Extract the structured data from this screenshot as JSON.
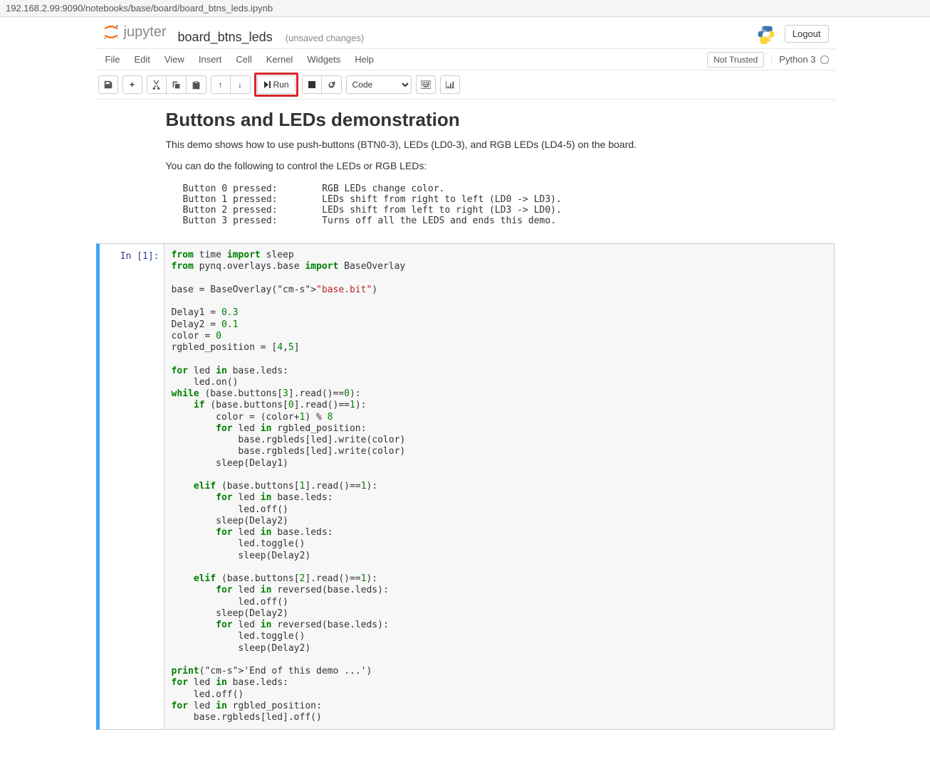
{
  "url": {
    "full": "192.168.2.99:9090/notebooks/base/board/board_btns_leds.ipynb"
  },
  "header": {
    "jupyter_brand": "jupyter",
    "notebook_name": "board_btns_leds",
    "save_status": "(unsaved changes)",
    "logout": "Logout"
  },
  "menu": {
    "items": [
      "File",
      "Edit",
      "View",
      "Insert",
      "Cell",
      "Kernel",
      "Widgets",
      "Help"
    ],
    "trust": "Not Trusted",
    "kernel": "Python 3"
  },
  "toolbar": {
    "run_label": "Run",
    "cell_type": "Code"
  },
  "markdown": {
    "title": "Buttons and LEDs demonstration",
    "p1": "This demo shows how to use push-buttons (BTN0-3), LEDs (LD0-3), and RGB LEDs (LD4-5) on the board.",
    "p2": "You can do the following to control the LEDs or RGB LEDs:",
    "pre": "Button 0 pressed:        RGB LEDs change color.\nButton 1 pressed:        LEDs shift from right to left (LD0 -> LD3).\nButton 2 pressed:        LEDs shift from left to right (LD3 -> LD0).\nButton 3 pressed:        Turns off all the LEDS and ends this demo."
  },
  "cell1": {
    "prompt": "In [1]:",
    "code_plain": "from time import sleep\nfrom pynq.overlays.base import BaseOverlay\n\nbase = BaseOverlay(\"base.bit\")\n\nDelay1 = 0.3\nDelay2 = 0.1\ncolor = 0\nrgbled_position = [4,5]\n\nfor led in base.leds:\n    led.on()\nwhile (base.buttons[3].read()==0):\n    if (base.buttons[0].read()==1):\n        color = (color+1) % 8\n        for led in rgbled_position:\n            base.rgbleds[led].write(color)\n            base.rgbleds[led].write(color)\n        sleep(Delay1)\n        \n    elif (base.buttons[1].read()==1):\n        for led in base.leds:\n            led.off()\n        sleep(Delay2)\n        for led in base.leds:\n            led.toggle()\n            sleep(Delay2)\n            \n    elif (base.buttons[2].read()==1):\n        for led in reversed(base.leds):\n            led.off()\n        sleep(Delay2)\n        for led in reversed(base.leds):\n            led.toggle()\n            sleep(Delay2)\n            \nprint('End of this demo ...')\nfor led in base.leds:\n    led.off()\nfor led in rgbled_position:\n    base.rgbleds[led].off()"
  }
}
